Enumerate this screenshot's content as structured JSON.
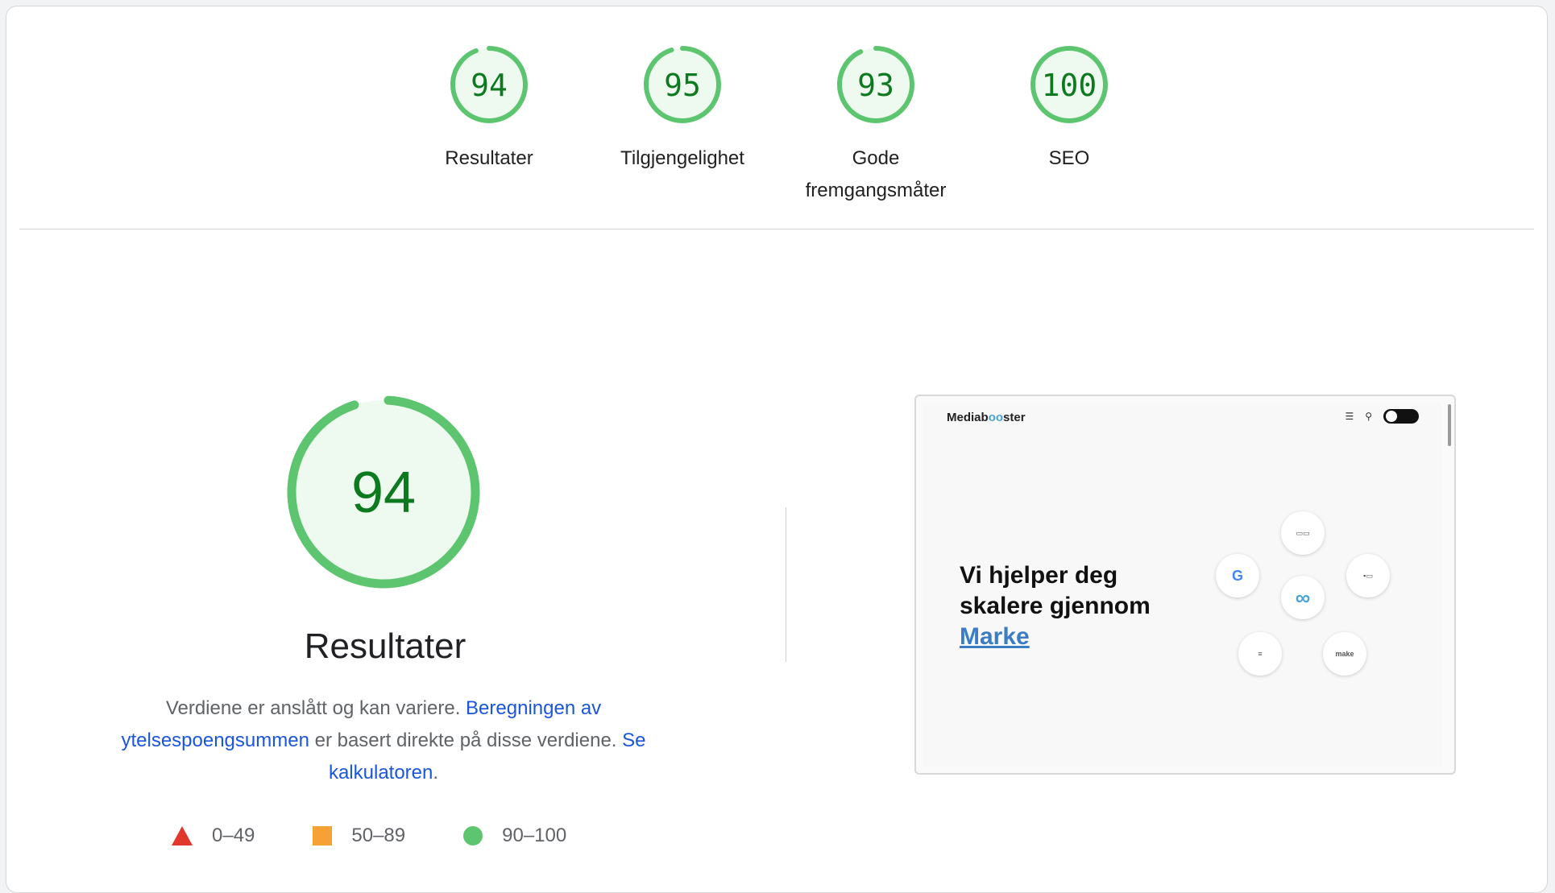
{
  "colors": {
    "pass_green": "#0cce6b",
    "ring_green": "#5dc56f",
    "score_text": "#0d7a1f",
    "fail_red": "#e0392b",
    "average_orange": "#f4a236",
    "link_blue": "#1a56db"
  },
  "categories": [
    {
      "score": "94",
      "label": "Resultater"
    },
    {
      "score": "95",
      "label": "Tilgjengelighet"
    },
    {
      "score": "93",
      "label": "Gode fremgangsmåter"
    },
    {
      "score": "100",
      "label": "SEO"
    }
  ],
  "performance": {
    "score": "94",
    "title": "Resultater",
    "desc_text1": "Verdiene er anslått og kan variere. ",
    "desc_link1": "Beregningen av ytelsespoengsummen",
    "desc_text2": " er basert direkte på disse verdiene. ",
    "desc_link2": "Se kalkulatoren",
    "desc_text3": "."
  },
  "legend": {
    "fail": "0–49",
    "average": "50–89",
    "pass": "90–100"
  },
  "screenshot": {
    "logo_prefix": "Mediab",
    "logo_oo": "oo",
    "logo_suffix": "ster",
    "headline": "Vi hjelper deg skalere gjennom",
    "headline_link": "Marke",
    "bubble_google": "G",
    "bubble_make": "make"
  }
}
